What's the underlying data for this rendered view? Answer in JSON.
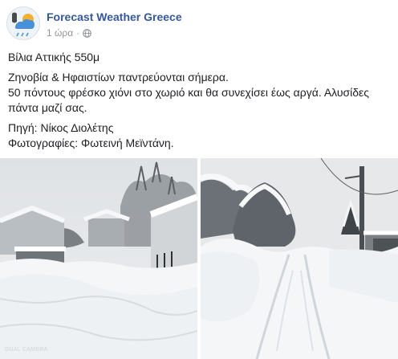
{
  "post": {
    "page_name": "Forecast Weather Greece",
    "timestamp": "1 ώρα",
    "separator": "·",
    "privacy_icon": "globe-icon",
    "paragraphs": [
      {
        "lines": [
          "Βίλια Αττικής 550μ"
        ]
      },
      {
        "lines": [
          "Ζηνοβία & Ηφαιστίων παντρεύονται σήμερα.",
          "50 πόντους φρέσκο χιόνι στο χωριό και θα συνεχίσει έως αργά. Αλυσίδες πάντα μαζί σας."
        ]
      },
      {
        "lines": [
          "Πηγή: Νίκος Διολέτης",
          "Φωτογραφίες: Φωτεινή Μεϊντάνη."
        ]
      }
    ]
  },
  "photos": {
    "left": {
      "watermark": "DUAL CAMERA"
    }
  },
  "colors": {
    "page_name": "#365899",
    "meta_text": "#90949c",
    "body_text": "#1c1e21"
  }
}
